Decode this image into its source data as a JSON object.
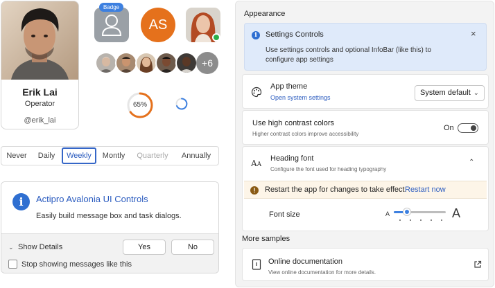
{
  "profile": {
    "name": "Erik Lai",
    "role": "Operator",
    "handle": "@erik_lai"
  },
  "avatars": {
    "badge_label": "Badge",
    "initials": "AS",
    "initials_color": "#e5711c",
    "presence_color": "#2bb04a",
    "group_overflow": "+6"
  },
  "progress": {
    "value_label": "65%",
    "value": 65
  },
  "segmented": {
    "options": [
      "Never",
      "Daily",
      "Weekly",
      "Montly",
      "Quarterly",
      "Annually"
    ],
    "selected": "Weekly",
    "disabled": "Quarterly"
  },
  "message": {
    "title": "Actipro Avalonia UI Controls",
    "body": "Easily build message box and task dialogs.",
    "show_details": "Show Details",
    "yes": "Yes",
    "no": "No",
    "checkbox_label": "Stop showing messages like this"
  },
  "settings": {
    "appearance_title": "Appearance",
    "infobar": {
      "title": "Settings Controls",
      "line1": "Use settings controls and optional InfoBar (like this) to",
      "line2": "configure app settings"
    },
    "app_theme": {
      "title": "App theme",
      "link": "Open system settings",
      "value": "System default"
    },
    "high_contrast": {
      "title": "Use high contrast colors",
      "desc": "Higher contrast colors improve accessibility",
      "state": "On"
    },
    "heading_font": {
      "title": "Heading font",
      "desc": "Configure the font used for heading typography"
    },
    "warning": {
      "text": "Restart the app for changes to take effect.",
      "link": "Restart now"
    },
    "font_size": {
      "label": "Font size",
      "small": "A",
      "large": "A",
      "value_fraction": 0.25
    },
    "more_samples_title": "More samples",
    "online_docs": {
      "title": "Online documentation",
      "desc": "View online documentation for more details."
    }
  }
}
